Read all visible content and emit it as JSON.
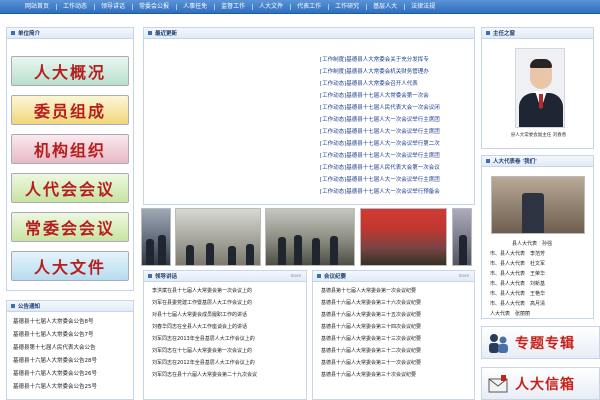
{
  "nav": {
    "items": [
      "网站首页",
      "工作动态",
      "领导讲话",
      "常委会公报",
      "人事任免",
      "监督工作",
      "人大文件",
      "代表工作",
      "工作研究",
      "基层人大",
      "法律法规"
    ]
  },
  "intro": {
    "title": "单位简介",
    "buttons": [
      "人大概况",
      "委员组成",
      "机构组织",
      "人代会会议",
      "常委会会议",
      "人大文件"
    ]
  },
  "notices": {
    "title": "公告通知",
    "items": [
      "基德县十七届人大常委会公告8号",
      "基德县十七届人大常委会公告7号",
      "基德县第十七届人民代表大会公告",
      "基德县十六届人大常委会公告28号",
      "基德县十六届人大常委会公告26号",
      "基德县十六届人大常委会公告25号"
    ]
  },
  "latest": {
    "title": "最近更新",
    "items": [
      "[工作制度]基德县人大常委会关于充分发挥专",
      "[工作制度]基德县人大常委会机关财务管理办",
      "[工作动态]基德县人大常委会召开人代表",
      "[工作动态]基德县十七届人大常委会第一次会",
      "[工作动态]基德县十七届人民代表大会一次会议闭",
      "[工作动态]基德县十七届人大一次会议举行主席团",
      "[工作动态]基德县十七届人大一次会议举行主席团",
      "[工作动态]基德县十七届人大一次会议举行第二次",
      "[工作动态]基德县十七届人大一次会议举行主席团",
      "[工作动态]基德县十七届人民代表大会第一次会议",
      "[工作动态]基德县十七届人大一次会议举行主席团",
      "[工作动态]基德县十七届人大一次会议举行预备会"
    ]
  },
  "speech": {
    "title": "领导讲话",
    "more": "more",
    "items": [
      "李洪斌在县十七届人大常委会第一次会议上的",
      "刘军在县委党建工作暨基层人大工作会议上的",
      "对县十七届人大常委会成员履职工作的讲话",
      "刘春华同志在全县人大工作座谈会上的讲话",
      "刘军同志在2013年全县基层人大工作会议上的",
      "刘军同志在十七届人大常委会第一次会议上的",
      "刘军同志在2012年全县基层人大工作会议上的",
      "刘军同志在县十六届人大常委会第二十九次会议"
    ]
  },
  "meetings": {
    "title": "会议纪要",
    "more": "more",
    "items": [
      "基德县第十七届人大常委会第一次会议纪要",
      "基德县十六届人大常委会第三十六次会议纪要",
      "基德县十六届人大常委会第三十五次会议纪要",
      "基德县十六届人大常委会第三十四次会议纪要",
      "基德县十六届人大常委会第三十三次会议纪要",
      "基德县十六届人大常委会第三十二次会议纪要",
      "基德县十六届人大常委会第三十一次会议纪要",
      "基德县十六届人大常委会第三十次会议纪要"
    ]
  },
  "director": {
    "title": "主任之窗",
    "caption": "县人大常委会副主任 刘春善"
  },
  "reps": {
    "title": "人大代表卷 '我们'",
    "name": "县人大代表　孙强",
    "lines": [
      "市、县人大代表　李范芳",
      "市、县人大代表　杜文军",
      "市、县人大代表　王荣华",
      "市、县人大代表　刘新基",
      "市、县人大代表　王艳华",
      "市、县人大代表　高月清",
      "人大代表　张丽丽"
    ]
  },
  "banners": {
    "topic": "专题专辑",
    "mailbox": "人大信箱"
  }
}
